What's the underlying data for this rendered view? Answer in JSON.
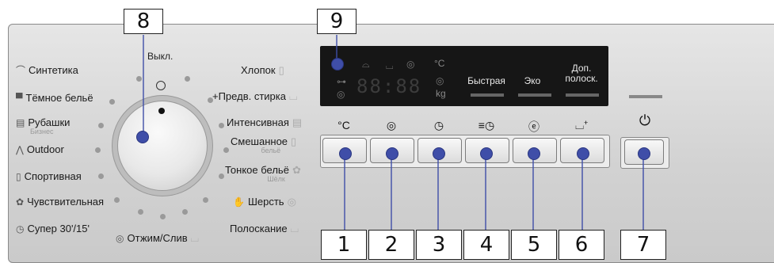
{
  "callouts": {
    "n1": "1",
    "n2": "2",
    "n3": "3",
    "n4": "4",
    "n5": "5",
    "n6": "6",
    "n7": "7",
    "n8": "8",
    "n9": "9"
  },
  "dial": {
    "off_label": "Выкл.",
    "left": [
      {
        "label": "Синтетика",
        "sub": "",
        "icon": "⌒"
      },
      {
        "label": "Тёмное бельё",
        "sub": "",
        "icon": "▀"
      },
      {
        "label": "Рубашки",
        "sub": "Бизнес",
        "icon": "▤"
      },
      {
        "label": "Outdoor",
        "sub": "",
        "icon": "⋀"
      },
      {
        "label": "Спортивная",
        "sub": "",
        "icon": "▯"
      },
      {
        "label": "Чувствительная",
        "sub": "",
        "icon": "✿"
      },
      {
        "label": "Супер 30'/15'",
        "sub": "",
        "icon": "◷"
      }
    ],
    "right": [
      {
        "label": "Хлопок",
        "sub": "",
        "icon": "▯"
      },
      {
        "label": "+Предв. стирка",
        "sub": "",
        "icon": "⌴"
      },
      {
        "label": "Интенсивная",
        "sub": "",
        "icon": "▤"
      },
      {
        "label": "Смешанное",
        "sub": "бельё",
        "icon": "▯"
      },
      {
        "label": "Тонкое бельё",
        "sub": "Шёлк",
        "icon": "✿"
      },
      {
        "label": "Шерсть",
        "sub": "",
        "icon": "◎"
      },
      {
        "label": "Полоскание",
        "sub": "",
        "icon": "⌴"
      }
    ],
    "bottom": {
      "label": "Отжим/Слив",
      "icon": "◎"
    }
  },
  "display": {
    "digits": "88:88",
    "temp_unit": "°C",
    "weight_unit": "kg",
    "options": [
      "Быстрая",
      "Эко",
      "Доп.\nполоск."
    ]
  },
  "buttons": [
    {
      "symbol": "°C",
      "name": "temperature-button"
    },
    {
      "symbol": "◎",
      "name": "spin-button"
    },
    {
      "symbol": "◷",
      "name": "time-button"
    },
    {
      "symbol": "≡◷",
      "name": "delay-button"
    },
    {
      "symbol": "ⓔ",
      "name": "eco-button"
    },
    {
      "symbol": "⌴⁺",
      "name": "extra-rinse-button"
    }
  ],
  "start": {
    "symbol": "⏻"
  }
}
